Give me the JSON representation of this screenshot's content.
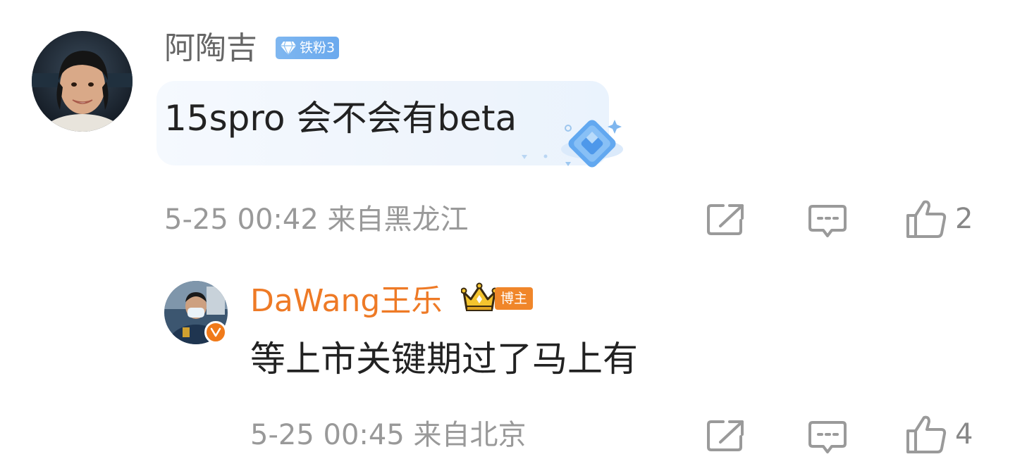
{
  "comments": [
    {
      "username": "阿陶吉",
      "fan_badge": "铁粉3",
      "content": "15spro 会不会有beta",
      "time": "5-25 00:42",
      "location": "来自黑龙江",
      "meta": "5-25 00:42 来自黑龙江",
      "likes": "2"
    },
    {
      "username": "DaWang王乐",
      "blogger_badge": "博主",
      "verified": true,
      "content": "等上市关键期过了马上有",
      "time": "5-25 00:45",
      "location": "来自北京",
      "meta": "5-25 00:45 来自北京",
      "likes": "4"
    }
  ],
  "colors": {
    "username_default": "#666666",
    "username_blogger": "#ee7a26",
    "fan_badge": "#6aa9ee",
    "blogger_badge": "#f0862a",
    "meta_text": "#999999",
    "icon": "#9a9a9a"
  },
  "icons": [
    "forward-icon",
    "reply-icon",
    "like-icon",
    "diamond-icon",
    "crown-icon",
    "verified-icon"
  ]
}
